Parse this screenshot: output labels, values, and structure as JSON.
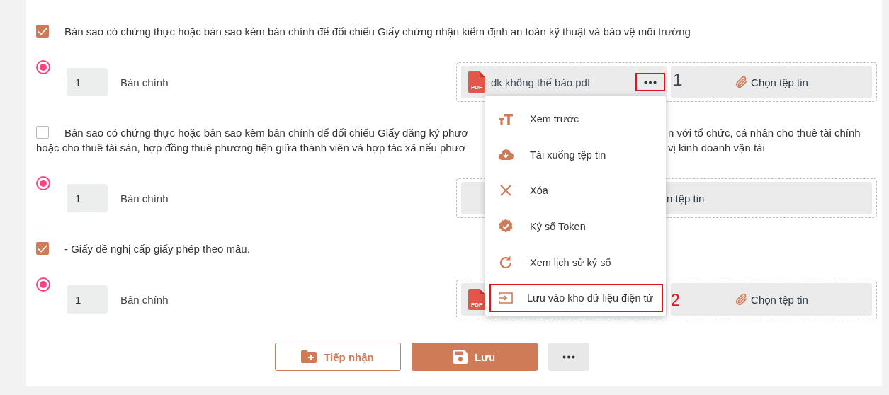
{
  "documents": [
    {
      "checked": true,
      "title_lines": [
        [
          "Bản sao có chứng thực hoặc bản sao kèm bản chính để đối chiếu Giấy chứng nhận kiểm định an toàn kỹ thuật và bảo vệ môi trường"
        ]
      ],
      "copy": {
        "selected": true,
        "count": "1",
        "label": "Bản chính"
      },
      "file": {
        "kind": "attached",
        "icon_label": "PDF",
        "name": "dk khổng thế bảo.pdf",
        "choose_label": "Chọn tệp tin",
        "annotation": "1"
      }
    },
    {
      "checked": false,
      "title_lines": [
        [
          "Bản sao có chứng thực hoặc bản sao kèm bản chính để đối chiếu Giấy đăng ký phươ",
          "n với tổ chức, cá nhân cho thuê tài chính"
        ],
        [
          "hoặc cho thuê tài sản, hợp đồng thuê phương tiện giữa thành viên và hợp tác xã nếu phươ",
          "vị kinh doanh vận tải"
        ]
      ],
      "copy": {
        "selected": true,
        "count": "1",
        "label": "Bản chính"
      },
      "file": {
        "kind": "empty",
        "choose_label": "n tệp tin"
      }
    },
    {
      "checked": true,
      "title_lines": [
        [
          "- Giấy đề nghị cấp giấy phép theo mẫu."
        ]
      ],
      "copy": {
        "selected": true,
        "count": "1",
        "label": "Bản chính"
      },
      "file": {
        "kind": "attached",
        "icon_label": "PDF",
        "choose_label": "Chọn tệp tin"
      }
    }
  ],
  "menu": {
    "items": [
      {
        "label": "Xem trước"
      },
      {
        "label": "Tải xuống tệp tin"
      },
      {
        "label": "Xóa"
      },
      {
        "label": "Ký số Token"
      },
      {
        "label": "Xem lịch sử ký số"
      },
      {
        "label": "Lưu vào kho dữ liệu điện tử",
        "annotation": "2"
      }
    ]
  },
  "actions": [
    {
      "kind": "outline",
      "label": "Tiếp nhận"
    },
    {
      "kind": "primary",
      "label": "Lưu"
    },
    {
      "kind": "more"
    }
  ]
}
